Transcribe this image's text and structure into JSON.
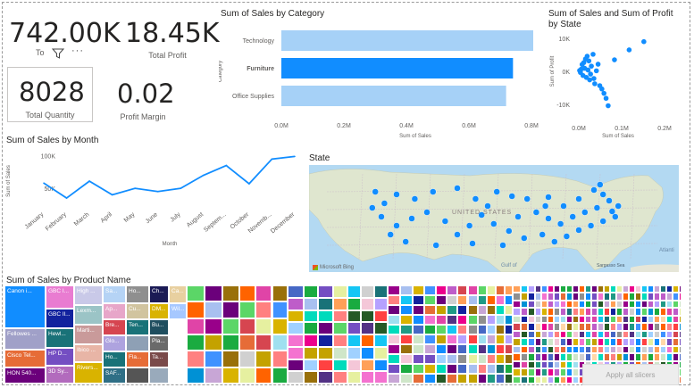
{
  "kpis": {
    "total_sales_value": "742.00K",
    "total_sales_label": "To",
    "total_profit_value": "18.45K",
    "total_profit_label": "Total Profit",
    "total_quantity_value": "8028",
    "total_quantity_label": "Total Quantity",
    "profit_margin_value": "0.02",
    "profit_margin_label": "Profit Margin"
  },
  "category_chart": {
    "title": "Sum of Sales by Category",
    "axis_label": "Category",
    "value_axis_label": "Sum of Sales",
    "chart_data": {
      "type": "bar",
      "categories": [
        "Technology",
        "Furniture",
        "Office Supplies"
      ],
      "values": [
        836000,
        741000,
        719000
      ],
      "highlighted": "Furniture",
      "xlim": [
        0,
        800000
      ],
      "ticks": [
        "0.0M",
        "0.2M",
        "0.4M",
        "0.6M",
        "0.8M"
      ],
      "colors": {
        "normal": "#a6d1f7",
        "highlight": "#118dff"
      }
    }
  },
  "state_scatter": {
    "title": "Sum of Sales and Sum of Profit by State",
    "x_label": "Sum of Sales",
    "y_label": "Sum of Profit",
    "chart_data": {
      "type": "scatter",
      "x_ticks": [
        "0.0M",
        "0.1M",
        "0.2M"
      ],
      "y_ticks": [
        "10K",
        "0K",
        "-10K"
      ],
      "xlim": [
        0,
        0.2
      ],
      "ylim": [
        -12,
        12
      ],
      "points": [
        {
          "x": 0.002,
          "y": 0.3
        },
        {
          "x": 0.004,
          "y": -0.4
        },
        {
          "x": 0.006,
          "y": 0.8
        },
        {
          "x": 0.008,
          "y": 2.5
        },
        {
          "x": 0.01,
          "y": -1.5
        },
        {
          "x": 0.012,
          "y": 3.2
        },
        {
          "x": 0.014,
          "y": 1.1
        },
        {
          "x": 0.016,
          "y": 4.5
        },
        {
          "x": 0.018,
          "y": -2.2
        },
        {
          "x": 0.02,
          "y": 5.5
        },
        {
          "x": 0.022,
          "y": 0.5
        },
        {
          "x": 0.024,
          "y": 3.8
        },
        {
          "x": 0.026,
          "y": -3.1
        },
        {
          "x": 0.03,
          "y": 1.9
        },
        {
          "x": 0.034,
          "y": 6.2
        },
        {
          "x": 0.038,
          "y": -4.5
        },
        {
          "x": 0.042,
          "y": 0.2
        },
        {
          "x": 0.046,
          "y": 2.6
        },
        {
          "x": 0.05,
          "y": -5.2
        },
        {
          "x": 0.055,
          "y": -6.4
        },
        {
          "x": 0.06,
          "y": -8.0
        },
        {
          "x": 0.065,
          "y": -9.8
        },
        {
          "x": 0.07,
          "y": -12.5
        },
        {
          "x": 0.085,
          "y": 4.2
        },
        {
          "x": 0.12,
          "y": 7.8
        },
        {
          "x": 0.155,
          "y": 10.8
        },
        {
          "x": 0.028,
          "y": -1.0
        },
        {
          "x": 0.036,
          "y": -2.6
        }
      ],
      "color": "#118dff"
    }
  },
  "month_chart": {
    "title": "Sum of Sales by Month",
    "x_label": "Month",
    "y_label": "Sum of Sales",
    "chart_data": {
      "type": "line",
      "x": [
        "January",
        "February",
        "March",
        "April",
        "May",
        "June",
        "July",
        "August",
        "Septem...",
        "October",
        "Novemb...",
        "December"
      ],
      "values": [
        58000,
        35000,
        61000,
        40000,
        50000,
        45000,
        50000,
        70000,
        85000,
        57000,
        95000,
        99000
      ],
      "y_ticks": [
        "100K",
        "50K"
      ],
      "ylim": [
        20000,
        105000
      ],
      "color": "#118dff"
    }
  },
  "map": {
    "title": "State",
    "labels": [
      "UNITED STATES",
      "Gulf of",
      "Sargasso Sea",
      "Atlanti",
      "Microsoft Bing"
    ],
    "color": "#118dff",
    "dots": [
      [
        0.13,
        0.22
      ],
      [
        0.2,
        0.25
      ],
      [
        0.16,
        0.35
      ],
      [
        0.26,
        0.3
      ],
      [
        0.32,
        0.22
      ],
      [
        0.4,
        0.18
      ],
      [
        0.46,
        0.3
      ],
      [
        0.53,
        0.22
      ],
      [
        0.58,
        0.27
      ],
      [
        0.63,
        0.3
      ],
      [
        0.7,
        0.28
      ],
      [
        0.75,
        0.38
      ],
      [
        0.8,
        0.3
      ],
      [
        0.85,
        0.2
      ],
      [
        0.88,
        0.25
      ],
      [
        0.9,
        0.32
      ],
      [
        0.86,
        0.4
      ],
      [
        0.91,
        0.44
      ],
      [
        0.92,
        0.5
      ],
      [
        0.88,
        0.55
      ],
      [
        0.84,
        0.6
      ],
      [
        0.8,
        0.65
      ],
      [
        0.76,
        0.72
      ],
      [
        0.72,
        0.78
      ],
      [
        0.68,
        0.7
      ],
      [
        0.62,
        0.74
      ],
      [
        0.57,
        0.66
      ],
      [
        0.52,
        0.58
      ],
      [
        0.48,
        0.48
      ],
      [
        0.44,
        0.6
      ],
      [
        0.4,
        0.7
      ],
      [
        0.36,
        0.55
      ],
      [
        0.3,
        0.45
      ],
      [
        0.25,
        0.52
      ],
      [
        0.2,
        0.6
      ],
      [
        0.15,
        0.5
      ],
      [
        0.12,
        0.4
      ],
      [
        0.18,
        0.7
      ],
      [
        0.23,
        0.78
      ],
      [
        0.33,
        0.82
      ],
      [
        0.45,
        0.8
      ],
      [
        0.55,
        0.82
      ],
      [
        0.6,
        0.5
      ],
      [
        0.66,
        0.45
      ],
      [
        0.7,
        0.52
      ],
      [
        0.74,
        0.58
      ],
      [
        0.78,
        0.5
      ],
      [
        0.82,
        0.45
      ],
      [
        0.93,
        0.38
      ],
      [
        0.87,
        0.14
      ],
      [
        0.69,
        0.38
      ],
      [
        0.5,
        0.38
      ]
    ]
  },
  "treemap": {
    "title": "Sum of Sales by Product Name",
    "apply_button": "Apply all slicers",
    "labels": [
      "Canon i...",
      "GBC I...",
      "High ...",
      "Sa...",
      "Ho...",
      "Ch...",
      "Ca...",
      "GBC Il...",
      "Lexm...",
      "Ap...",
      "Cu...",
      "DM...",
      "Bu...",
      "Wil...",
      "Fellowes ...",
      "Hewl...",
      "Marti...",
      "Bre...",
      "Ten...",
      "Pla...",
      "HP D...",
      "Ibico ...",
      "Glo...",
      "Cisco Tel...",
      "Rivers...",
      "Ho...",
      "Fla...",
      "HON 540...",
      "3D Sy...",
      "SAF...",
      "Ta..."
    ],
    "colors": {
      "teal": "#118dff",
      "navy": "#12239e",
      "orange": "#e66c37",
      "purple": "#6b007b",
      "pink": "#e044a7",
      "violet": "#744ec2",
      "yellow": "#d9b300",
      "red": "#d64550",
      "slate": "#197278",
      "lightblue": "#a6c8ff",
      "grey": "#8f8f8f"
    }
  }
}
